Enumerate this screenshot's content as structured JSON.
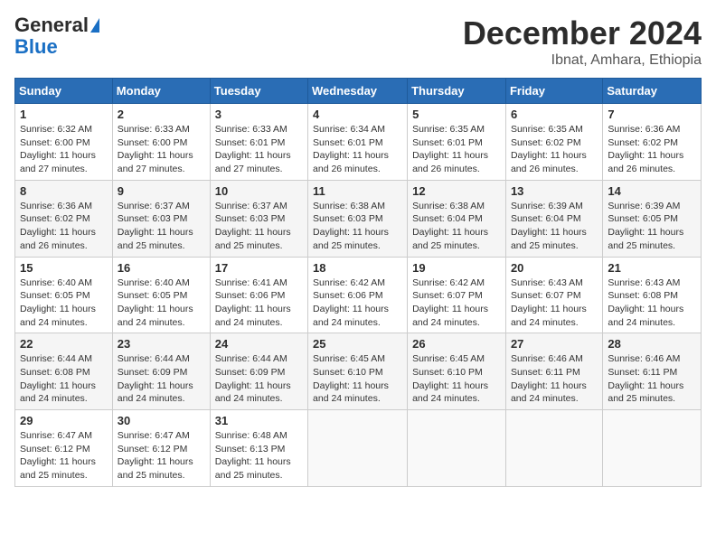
{
  "logo": {
    "general": "General",
    "blue": "Blue"
  },
  "title": "December 2024",
  "location": "Ibnat, Amhara, Ethiopia",
  "days_of_week": [
    "Sunday",
    "Monday",
    "Tuesday",
    "Wednesday",
    "Thursday",
    "Friday",
    "Saturday"
  ],
  "weeks": [
    [
      {
        "day": "1",
        "sunrise": "6:32 AM",
        "sunset": "6:00 PM",
        "daylight": "11 hours and 27 minutes."
      },
      {
        "day": "2",
        "sunrise": "6:33 AM",
        "sunset": "6:00 PM",
        "daylight": "11 hours and 27 minutes."
      },
      {
        "day": "3",
        "sunrise": "6:33 AM",
        "sunset": "6:01 PM",
        "daylight": "11 hours and 27 minutes."
      },
      {
        "day": "4",
        "sunrise": "6:34 AM",
        "sunset": "6:01 PM",
        "daylight": "11 hours and 26 minutes."
      },
      {
        "day": "5",
        "sunrise": "6:35 AM",
        "sunset": "6:01 PM",
        "daylight": "11 hours and 26 minutes."
      },
      {
        "day": "6",
        "sunrise": "6:35 AM",
        "sunset": "6:02 PM",
        "daylight": "11 hours and 26 minutes."
      },
      {
        "day": "7",
        "sunrise": "6:36 AM",
        "sunset": "6:02 PM",
        "daylight": "11 hours and 26 minutes."
      }
    ],
    [
      {
        "day": "8",
        "sunrise": "6:36 AM",
        "sunset": "6:02 PM",
        "daylight": "11 hours and 26 minutes."
      },
      {
        "day": "9",
        "sunrise": "6:37 AM",
        "sunset": "6:03 PM",
        "daylight": "11 hours and 25 minutes."
      },
      {
        "day": "10",
        "sunrise": "6:37 AM",
        "sunset": "6:03 PM",
        "daylight": "11 hours and 25 minutes."
      },
      {
        "day": "11",
        "sunrise": "6:38 AM",
        "sunset": "6:03 PM",
        "daylight": "11 hours and 25 minutes."
      },
      {
        "day": "12",
        "sunrise": "6:38 AM",
        "sunset": "6:04 PM",
        "daylight": "11 hours and 25 minutes."
      },
      {
        "day": "13",
        "sunrise": "6:39 AM",
        "sunset": "6:04 PM",
        "daylight": "11 hours and 25 minutes."
      },
      {
        "day": "14",
        "sunrise": "6:39 AM",
        "sunset": "6:05 PM",
        "daylight": "11 hours and 25 minutes."
      }
    ],
    [
      {
        "day": "15",
        "sunrise": "6:40 AM",
        "sunset": "6:05 PM",
        "daylight": "11 hours and 24 minutes."
      },
      {
        "day": "16",
        "sunrise": "6:40 AM",
        "sunset": "6:05 PM",
        "daylight": "11 hours and 24 minutes."
      },
      {
        "day": "17",
        "sunrise": "6:41 AM",
        "sunset": "6:06 PM",
        "daylight": "11 hours and 24 minutes."
      },
      {
        "day": "18",
        "sunrise": "6:42 AM",
        "sunset": "6:06 PM",
        "daylight": "11 hours and 24 minutes."
      },
      {
        "day": "19",
        "sunrise": "6:42 AM",
        "sunset": "6:07 PM",
        "daylight": "11 hours and 24 minutes."
      },
      {
        "day": "20",
        "sunrise": "6:43 AM",
        "sunset": "6:07 PM",
        "daylight": "11 hours and 24 minutes."
      },
      {
        "day": "21",
        "sunrise": "6:43 AM",
        "sunset": "6:08 PM",
        "daylight": "11 hours and 24 minutes."
      }
    ],
    [
      {
        "day": "22",
        "sunrise": "6:44 AM",
        "sunset": "6:08 PM",
        "daylight": "11 hours and 24 minutes."
      },
      {
        "day": "23",
        "sunrise": "6:44 AM",
        "sunset": "6:09 PM",
        "daylight": "11 hours and 24 minutes."
      },
      {
        "day": "24",
        "sunrise": "6:44 AM",
        "sunset": "6:09 PM",
        "daylight": "11 hours and 24 minutes."
      },
      {
        "day": "25",
        "sunrise": "6:45 AM",
        "sunset": "6:10 PM",
        "daylight": "11 hours and 24 minutes."
      },
      {
        "day": "26",
        "sunrise": "6:45 AM",
        "sunset": "6:10 PM",
        "daylight": "11 hours and 24 minutes."
      },
      {
        "day": "27",
        "sunrise": "6:46 AM",
        "sunset": "6:11 PM",
        "daylight": "11 hours and 24 minutes."
      },
      {
        "day": "28",
        "sunrise": "6:46 AM",
        "sunset": "6:11 PM",
        "daylight": "11 hours and 25 minutes."
      }
    ],
    [
      {
        "day": "29",
        "sunrise": "6:47 AM",
        "sunset": "6:12 PM",
        "daylight": "11 hours and 25 minutes."
      },
      {
        "day": "30",
        "sunrise": "6:47 AM",
        "sunset": "6:12 PM",
        "daylight": "11 hours and 25 minutes."
      },
      {
        "day": "31",
        "sunrise": "6:48 AM",
        "sunset": "6:13 PM",
        "daylight": "11 hours and 25 minutes."
      },
      null,
      null,
      null,
      null
    ]
  ]
}
